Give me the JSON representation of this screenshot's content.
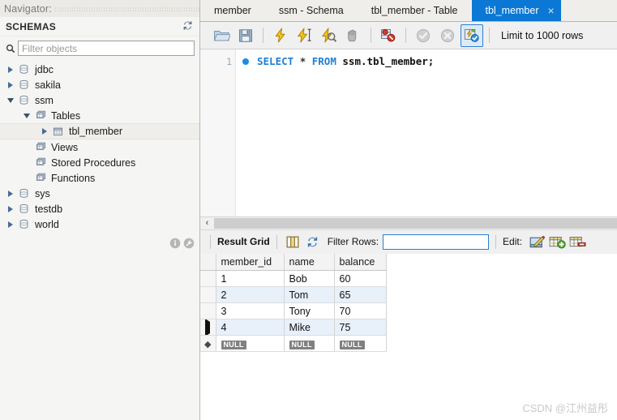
{
  "sidebar": {
    "navigator_title": "Navigator:",
    "schemas_header": "SCHEMAS",
    "refresh_icon": "refresh-icon",
    "filter": {
      "placeholder": "Filter objects",
      "value": "",
      "icon": "search-icon"
    },
    "tree": [
      {
        "label": "jdbc",
        "icon": "schema-icon",
        "indent": 0,
        "twisty": "right",
        "selected": false
      },
      {
        "label": "sakila",
        "icon": "schema-icon",
        "indent": 0,
        "twisty": "right",
        "selected": false
      },
      {
        "label": "ssm",
        "icon": "schema-icon",
        "indent": 0,
        "twisty": "down",
        "selected": false
      },
      {
        "label": "Tables",
        "icon": "folder-icon",
        "indent": 1,
        "twisty": "down",
        "selected": false
      },
      {
        "label": "tbl_member",
        "icon": "table-icon",
        "indent": 2,
        "twisty": "right",
        "selected": true
      },
      {
        "label": "Views",
        "icon": "folder-icon",
        "indent": 1,
        "twisty": "none",
        "selected": false
      },
      {
        "label": "Stored Procedures",
        "icon": "folder-icon",
        "indent": 1,
        "twisty": "none",
        "selected": false
      },
      {
        "label": "Functions",
        "icon": "folder-icon",
        "indent": 1,
        "twisty": "none",
        "selected": false
      },
      {
        "label": "sys",
        "icon": "schema-icon",
        "indent": 0,
        "twisty": "right",
        "selected": false
      },
      {
        "label": "testdb",
        "icon": "schema-icon",
        "indent": 0,
        "twisty": "right",
        "selected": false
      },
      {
        "label": "world",
        "icon": "schema-icon",
        "indent": 0,
        "twisty": "right",
        "selected": false
      }
    ],
    "footer_icons": [
      "info-icon",
      "wrench-icon"
    ]
  },
  "tabs": [
    {
      "label": "member",
      "active": false,
      "closable": false
    },
    {
      "label": "ssm - Schema",
      "active": false,
      "closable": false
    },
    {
      "label": "tbl_member - Table",
      "active": false,
      "closable": false
    },
    {
      "label": "tbl_member",
      "active": true,
      "closable": true,
      "close_glyph": "×"
    }
  ],
  "toolbar": {
    "buttons": [
      {
        "name": "open-sql-script-icon",
        "kind": "folder"
      },
      {
        "name": "save-sql-script-icon",
        "kind": "save"
      },
      {
        "name": "separator",
        "kind": "sep"
      },
      {
        "name": "execute-statement-icon",
        "kind": "bolt"
      },
      {
        "name": "execute-current-statement-icon",
        "kind": "bolt-cursor"
      },
      {
        "name": "explain-statement-icon",
        "kind": "bolt-magnifier"
      },
      {
        "name": "stop-execution-icon",
        "kind": "stop-hand"
      },
      {
        "name": "separator",
        "kind": "sep"
      },
      {
        "name": "toggle-stop-on-error-icon",
        "kind": "stop-error"
      },
      {
        "name": "separator",
        "kind": "sep"
      },
      {
        "name": "commit-transaction-icon",
        "kind": "check-disabled"
      },
      {
        "name": "rollback-transaction-icon",
        "kind": "cross-disabled"
      },
      {
        "name": "toggle-autocommit-icon",
        "kind": "autocommit",
        "selected": true
      },
      {
        "name": "separator",
        "kind": "sep"
      }
    ],
    "limit_label": "Limit to 1000 rows"
  },
  "editor": {
    "line_number": "1",
    "breakpoint_marker": "blue-dot",
    "sql": {
      "keyword1": "SELECT",
      "star": "*",
      "keyword2": "FROM",
      "identifier": "ssm.tbl_member;"
    },
    "full_text": "SELECT * FROM ssm.tbl_member;"
  },
  "hscrollbar": {
    "chevron": "‹"
  },
  "result_toolbar": {
    "result_grid_label": "Result Grid",
    "grid-view-icon": "grid-view-icon",
    "refresh-icon": "refresh-icon",
    "filter_rows_label": "Filter Rows:",
    "filter_rows_value": "",
    "edit_label": "Edit:",
    "edit_icons": [
      "edit-row-icon",
      "insert-row-icon",
      "delete-row-icon"
    ]
  },
  "result_grid": {
    "columns": [
      "member_id",
      "name",
      "balance"
    ],
    "rows": [
      {
        "marker": "none",
        "member_id": "1",
        "name": "Bob",
        "balance": "60"
      },
      {
        "marker": "none",
        "member_id": "2",
        "name": "Tom",
        "balance": "65"
      },
      {
        "marker": "none",
        "member_id": "3",
        "name": "Tony",
        "balance": "70"
      },
      {
        "marker": "arrow",
        "member_id": "4",
        "name": "Mike",
        "balance": "75"
      }
    ],
    "new_row": {
      "marker": "star",
      "member_id": "NULL",
      "name": "NULL",
      "balance": "NULL"
    }
  },
  "watermark": "CSDN @江州益彤",
  "colors": {
    "active_tab": "#0a78d4",
    "sql_keyword": "#1d7fd4",
    "row_stripe": "#e8f0fa",
    "null_badge": "#808080"
  }
}
